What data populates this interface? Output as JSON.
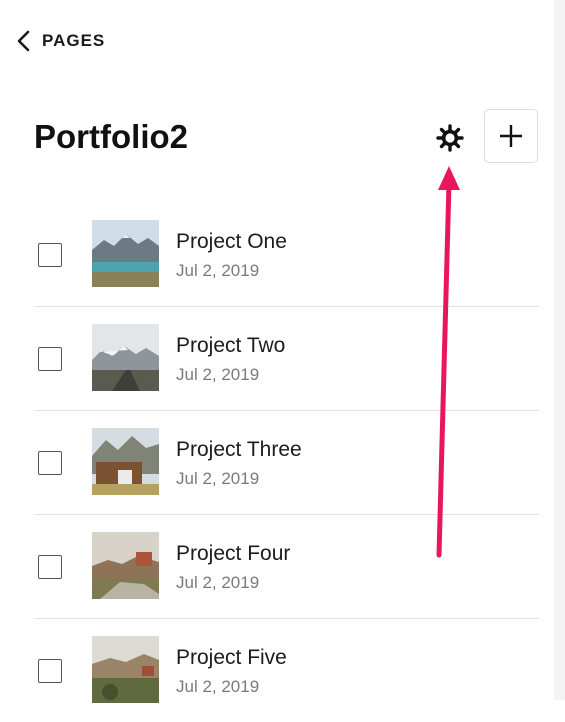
{
  "header": {
    "back_label": "PAGES",
    "title": "Portfolio2",
    "settings_icon": "gear-icon",
    "add_icon": "plus-icon"
  },
  "items": [
    {
      "title": "Project One",
      "date": "Jul 2, 2019"
    },
    {
      "title": "Project Two",
      "date": "Jul 2, 2019"
    },
    {
      "title": "Project Three",
      "date": "Jul 2, 2019"
    },
    {
      "title": "Project Four",
      "date": "Jul 2, 2019"
    },
    {
      "title": "Project Five",
      "date": "Jul 2, 2019"
    }
  ],
  "colors": {
    "annotation_arrow": "#e8175d",
    "divider": "#e2e2e2",
    "date_text": "#7a7a7a"
  }
}
